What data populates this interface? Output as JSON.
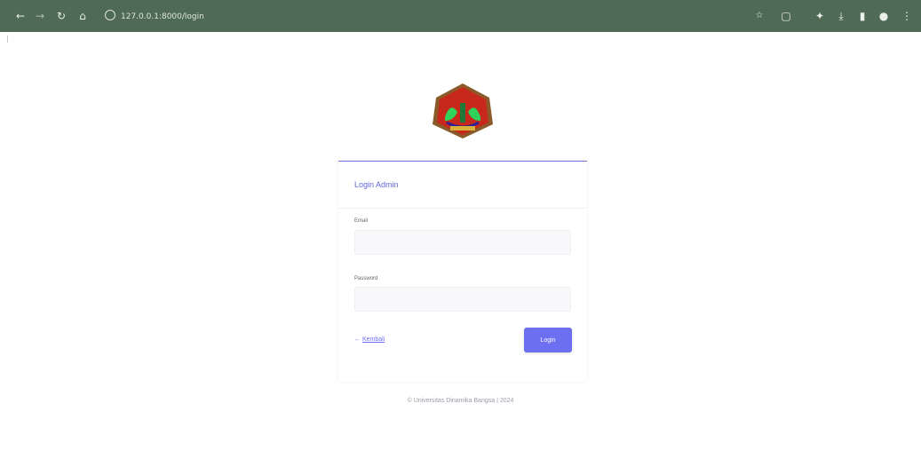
{
  "browser": {
    "url": "127.0.0.1:8000/login",
    "icons": [
      "back-arrow-icon",
      "forward-arrow-icon",
      "reload-icon",
      "home-icon",
      "site-info-icon",
      "star-icon",
      "screenshot-icon",
      "extensions-icon",
      "download-icon",
      "sidebar-icon",
      "profile-icon",
      "kebab-menu-icon"
    ]
  },
  "logo": {
    "name": "university-emblem"
  },
  "login_card": {
    "title": "Login Admin",
    "email_label": "Email",
    "email_value": "",
    "password_label": "Password",
    "password_value": "",
    "back_link": "Kembali",
    "login_button": "Login"
  },
  "footer": {
    "text": "© Universitas Dinamika Bangsa | 2024"
  },
  "colors": {
    "browser_bar": "#4f6a55",
    "accent": "#6b6ff0",
    "title": "#6366d8"
  }
}
